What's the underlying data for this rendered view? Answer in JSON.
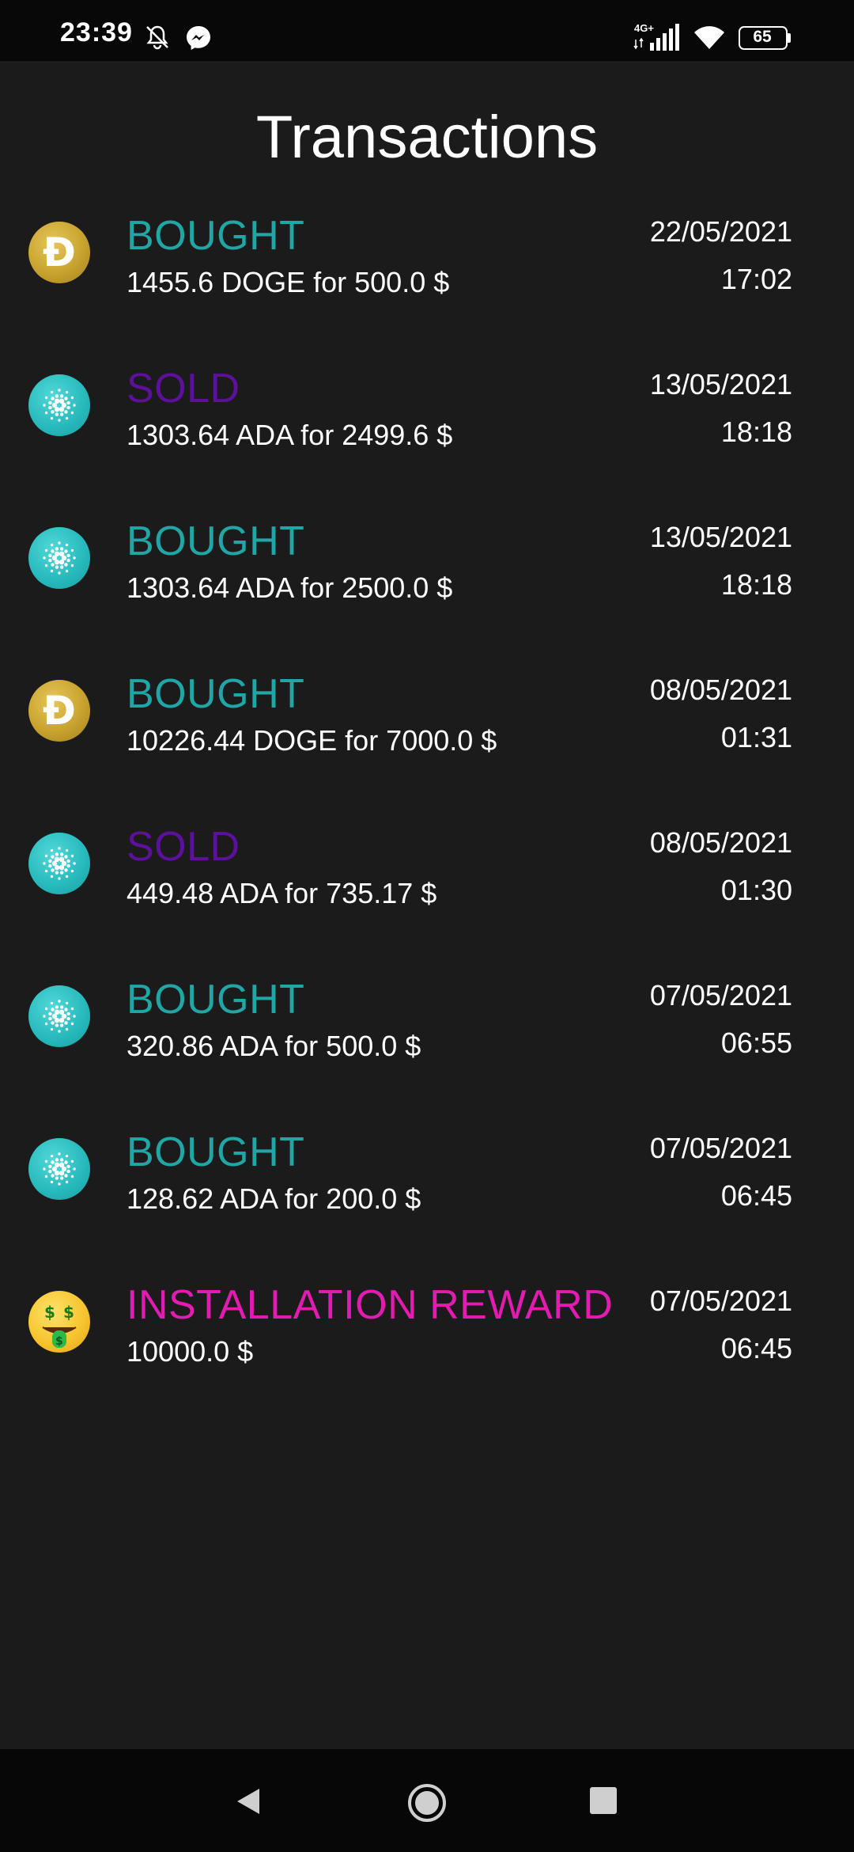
{
  "status_bar": {
    "time": "23:39",
    "network_label": "4G+",
    "battery": "65",
    "icons": [
      "bell-muted-icon",
      "messenger-icon",
      "signal-icon",
      "wifi-icon",
      "battery-icon"
    ]
  },
  "page": {
    "title": "Transactions"
  },
  "colors": {
    "bought": "#21a6a6",
    "sold": "#5c109c",
    "reward": "#e41bb0",
    "background": "#1b1b1b"
  },
  "transactions": [
    {
      "coin": "doge",
      "type": "BOUGHT",
      "detail": "1455.6 DOGE for 500.0 $",
      "date": "22/05/2021",
      "time": "17:02"
    },
    {
      "coin": "ada",
      "type": "SOLD",
      "detail": "1303.64 ADA for 2499.6 $",
      "date": "13/05/2021",
      "time": "18:18"
    },
    {
      "coin": "ada",
      "type": "BOUGHT",
      "detail": "1303.64 ADA for 2500.0 $",
      "date": "13/05/2021",
      "time": "18:18"
    },
    {
      "coin": "doge",
      "type": "BOUGHT",
      "detail": "10226.44 DOGE for 7000.0 $",
      "date": "08/05/2021",
      "time": "01:31"
    },
    {
      "coin": "ada",
      "type": "SOLD",
      "detail": "449.48 ADA for 735.17 $",
      "date": "08/05/2021",
      "time": "01:30"
    },
    {
      "coin": "ada",
      "type": "BOUGHT",
      "detail": "320.86 ADA for 500.0 $",
      "date": "07/05/2021",
      "time": "06:55"
    },
    {
      "coin": "ada",
      "type": "BOUGHT",
      "detail": "128.62 ADA for 200.0 $",
      "date": "07/05/2021",
      "time": "06:45"
    },
    {
      "coin": "money-face",
      "type": "INSTALLATION REWARD",
      "detail": "10000.0 $",
      "date": "07/05/2021",
      "time": "06:45"
    }
  ],
  "nav": {
    "icons": [
      "back-icon",
      "home-icon",
      "recents-icon"
    ]
  }
}
